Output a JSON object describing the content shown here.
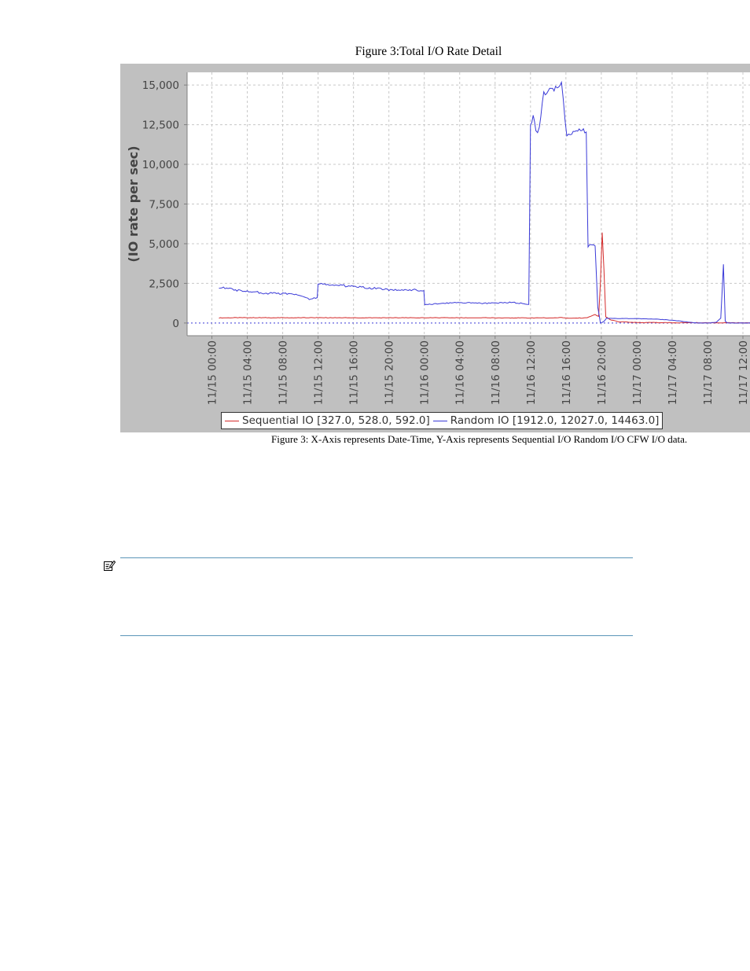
{
  "figure": {
    "title": "Figure 3:Total I/O Rate Detail",
    "caption": "Figure 3: X-Axis represents Date-Time, Y-Axis represents Sequential I/O Random I/O CFW I/O data."
  },
  "note": {
    "icon": "note-icon"
  },
  "chart_data": {
    "type": "line",
    "title": "Figure 3:Total I/O Rate Detail",
    "xlabel": "",
    "ylabel": "(IO rate per sec)",
    "y_ticks": [
      "0",
      "2,500",
      "5,000",
      "7,500",
      "10,000",
      "12,500",
      "15,000"
    ],
    "y_tick_values": [
      0,
      2500,
      5000,
      7500,
      10000,
      12500,
      15000
    ],
    "ylim": [
      -800,
      15800
    ],
    "x_ticks": [
      "11/15 00:00",
      "11/15 04:00",
      "11/15 08:00",
      "11/15 12:00",
      "11/15 16:00",
      "11/15 20:00",
      "11/16 00:00",
      "11/16 04:00",
      "11/16 08:00",
      "11/16 12:00",
      "11/16 16:00",
      "11/16 20:00",
      "11/17 00:00",
      "11/17 04:00",
      "11/17 08:00",
      "11/17 12:00"
    ],
    "x_tick_hours": [
      0,
      4,
      8,
      12,
      16,
      20,
      24,
      28,
      32,
      36,
      40,
      44,
      48,
      52,
      56,
      60
    ],
    "xlim_hours": [
      -2.8,
      60.8
    ],
    "grid": true,
    "legend_position": "bottom",
    "series": [
      {
        "name": "Sequential IO",
        "legend_label": "Sequential IO  [327.0, 528.0, 592.0]",
        "color": "#d42a2a",
        "x": [
          0.8,
          4,
          8,
          12,
          16,
          20,
          24,
          28,
          32,
          36,
          37.5,
          38,
          39.5,
          40,
          40.3,
          42.4,
          43,
          43.3,
          43.7,
          43.9,
          44.1,
          44.3,
          44.5,
          45,
          46,
          48,
          52,
          56,
          60,
          61
        ],
        "y": [
          327,
          340,
          330,
          335,
          330,
          330,
          330,
          330,
          330,
          320,
          340,
          310,
          340,
          320,
          300,
          330,
          480,
          530,
          420,
          2500,
          5700,
          3400,
          400,
          200,
          80,
          30,
          20,
          15,
          15,
          15
        ]
      },
      {
        "name": "Random IO",
        "legend_label": "Random IO  [1912.0, 12027.0, 14463.0]",
        "color": "#3a3ad8",
        "x": [
          0.8,
          2,
          3,
          4,
          5,
          6,
          7,
          8,
          9,
          10,
          11,
          11.9,
          12,
          14,
          16,
          18,
          20,
          22,
          23.95,
          24.05,
          26,
          28,
          30,
          32,
          34,
          35.8,
          36,
          36.3,
          36.6,
          37,
          37.5,
          38.5,
          39.5,
          40.1,
          40.3,
          41,
          41.5,
          42.3,
          42.5,
          43.3,
          43.6,
          43.9,
          44.3,
          44.6,
          46,
          48,
          50,
          52,
          54,
          55,
          56,
          57,
          57.5,
          57.8,
          58,
          58.3,
          58.5,
          60,
          61
        ],
        "y": [
          2250,
          2150,
          2050,
          2000,
          1950,
          1850,
          1900,
          1850,
          1850,
          1700,
          1500,
          1600,
          2500,
          2400,
          2300,
          2200,
          2100,
          2100,
          2050,
          1150,
          1250,
          1300,
          1250,
          1250,
          1300,
          1200,
          12500,
          13000,
          12100,
          12200,
          14500,
          14700,
          15050,
          11900,
          11800,
          12100,
          12300,
          12100,
          4900,
          4900,
          1000,
          0,
          100,
          300,
          280,
          280,
          250,
          180,
          50,
          0,
          0,
          50,
          300,
          3600,
          100,
          0,
          0,
          0,
          0
        ]
      }
    ]
  }
}
